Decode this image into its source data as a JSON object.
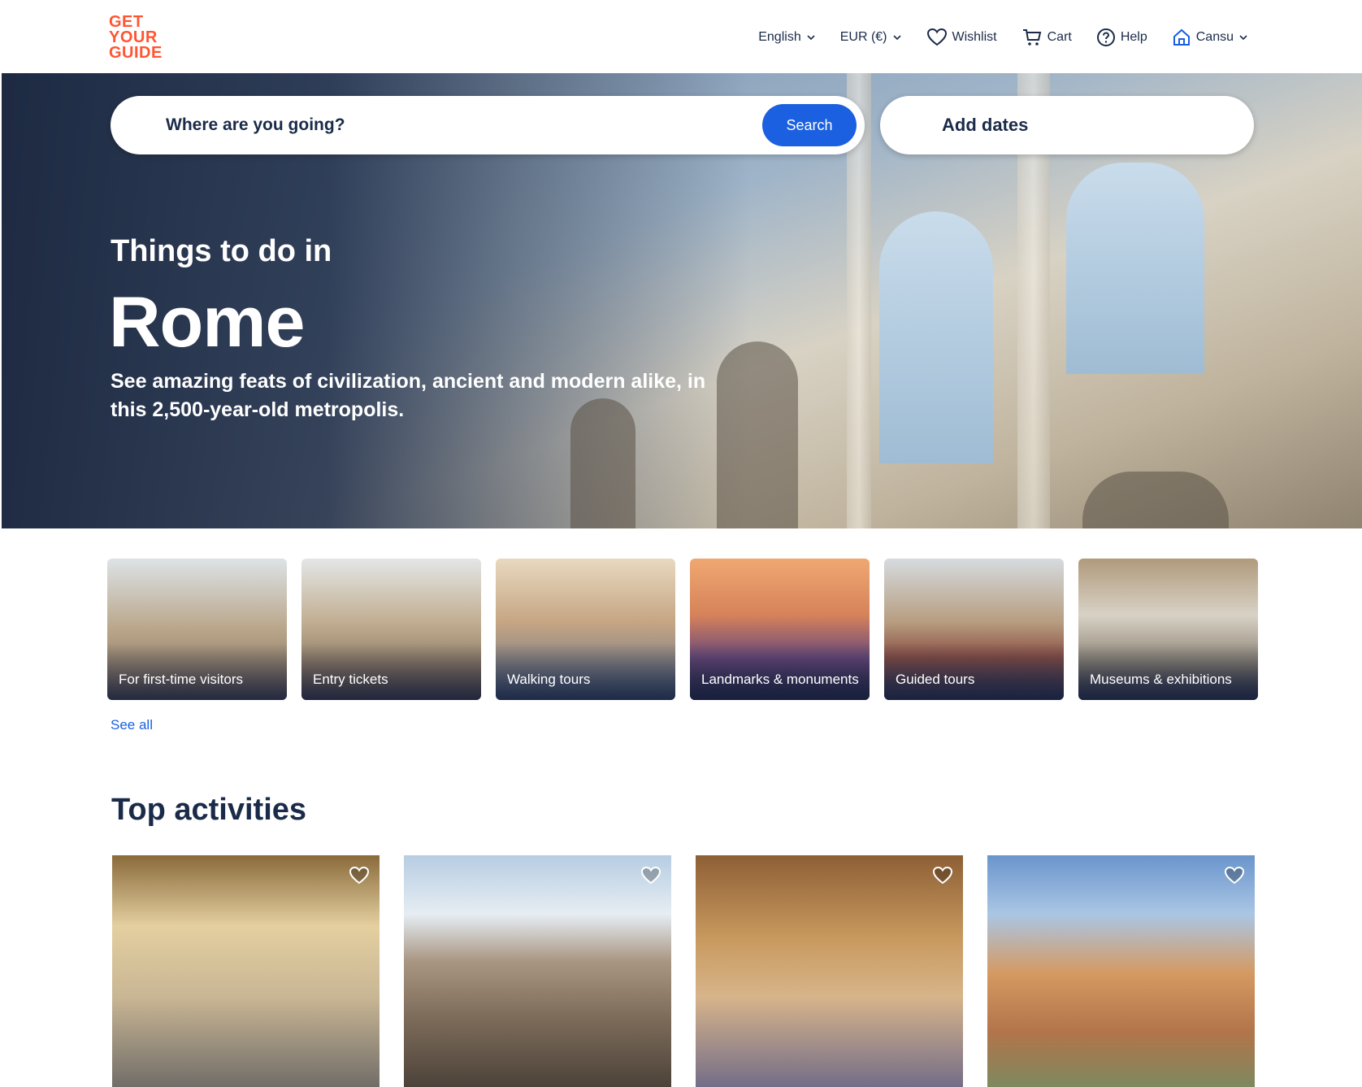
{
  "header": {
    "logo_lines": [
      "GET",
      "YOUR",
      "GUIDE"
    ],
    "nav": {
      "language": "English",
      "currency": "EUR (€)",
      "wishlist": "Wishlist",
      "cart": "Cart",
      "help": "Help",
      "user": "Cansu"
    },
    "icons": [
      "chevron-down-icon",
      "heart-icon",
      "cart-icon",
      "help-icon",
      "user-icon"
    ]
  },
  "hero": {
    "search_placeholder": "Where are you going?",
    "search_button": "Search",
    "dates_label": "Add dates",
    "pre_title": "Things to do in",
    "title": "Rome",
    "description": "See amazing feats of civilization, ancient and modern alike, in this 2,500-year-old metropolis."
  },
  "categories": [
    {
      "label": "For first-time visitors"
    },
    {
      "label": "Entry tickets"
    },
    {
      "label": "Walking tours"
    },
    {
      "label": "Landmarks & monuments"
    },
    {
      "label": "Guided tours"
    },
    {
      "label": "Museums & exhibitions"
    }
  ],
  "see_all": "See all",
  "top_activities": {
    "title": "Top activities"
  },
  "colors": {
    "brand": "#ff5533",
    "primary": "#1a60e0",
    "text": "#1a2b49"
  }
}
